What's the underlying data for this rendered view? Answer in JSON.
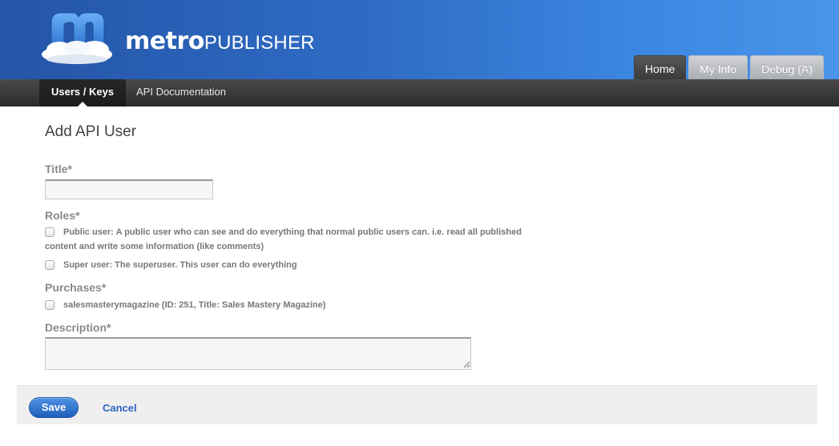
{
  "brand": {
    "part1": "metro",
    "part2": "PUBLISHER"
  },
  "top_tabs": [
    {
      "label": "Home",
      "active": true
    },
    {
      "label": "My Info",
      "active": false
    },
    {
      "label": "Debug (A)",
      "active": false
    }
  ],
  "nav": [
    {
      "label": "Users / Keys",
      "active": true
    },
    {
      "label": "API Documentation",
      "active": false
    }
  ],
  "form": {
    "title": "Add API User",
    "title_field": {
      "label": "Title*",
      "value": ""
    },
    "roles": {
      "label": "Roles*",
      "options": [
        {
          "line1": "Public user: A public user who can see and do everything that normal public users can. i.e. read all published",
          "line2": "content and write some information (like comments)",
          "checked": false
        },
        {
          "line1": "Super user: The superuser. This user can do everything",
          "checked": false
        }
      ]
    },
    "purchases": {
      "label": "Purchases*",
      "options": [
        {
          "line1": "salesmasterymagazine (ID: 251, Title: Sales Mastery Magazine)",
          "checked": false
        }
      ]
    },
    "description": {
      "label": "Description*",
      "value": ""
    }
  },
  "footer": {
    "save_label": "Save",
    "cancel_label": "Cancel"
  },
  "colors": {
    "header_start": "#2455a6",
    "header_end": "#4a95ea",
    "accent": "#2e65c4"
  }
}
